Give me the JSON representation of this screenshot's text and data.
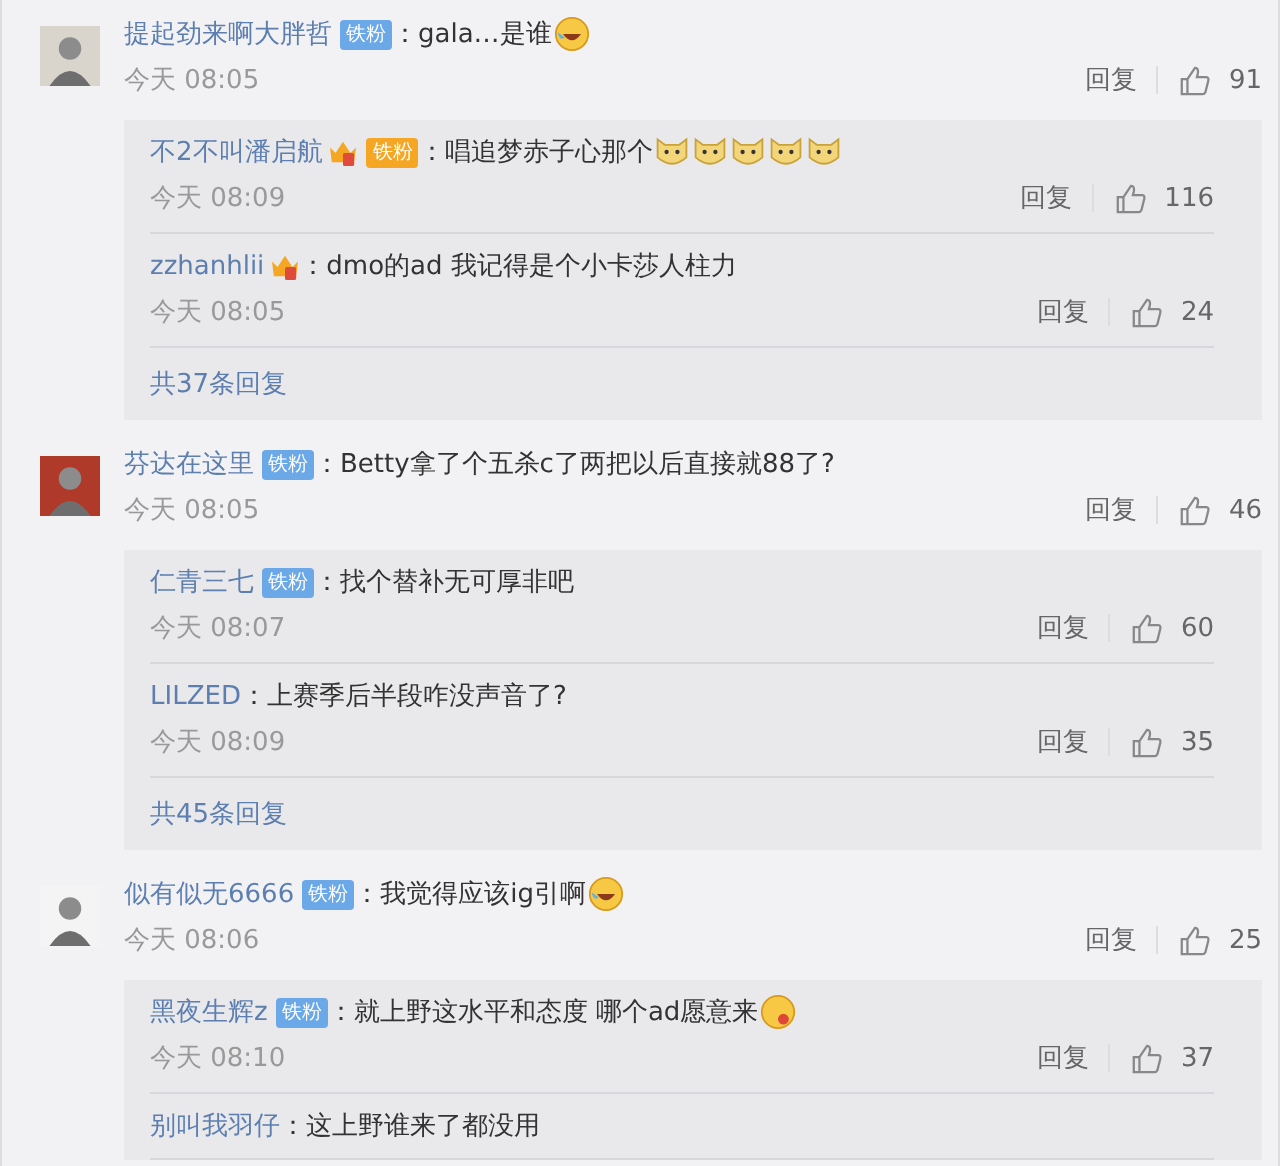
{
  "comments": [
    {
      "avatar": {
        "kind": "picture"
      },
      "name": "提起劲来啊大胖哲",
      "badges": [
        {
          "kind": "fan",
          "label": "铁粉",
          "color": "#6aa8e8"
        }
      ],
      "text": "：gala…是谁",
      "emojis": [
        {
          "kind": "laugh-cry"
        }
      ],
      "time": "今天 08:05",
      "reply_label": "回复",
      "likes": "91",
      "replies": [
        {
          "name": "不2不叫潘启航",
          "badges": [
            {
              "kind": "crown"
            },
            {
              "kind": "fan",
              "label": "铁粉",
              "color": "#f5a623"
            }
          ],
          "text": "：唱追梦赤子心那个",
          "emojis": [
            {
              "kind": "doge"
            },
            {
              "kind": "doge"
            },
            {
              "kind": "doge"
            },
            {
              "kind": "doge"
            },
            {
              "kind": "doge"
            }
          ],
          "time": "今天 08:09",
          "reply_label": "回复",
          "likes": "116"
        },
        {
          "name": "zzhanhlii",
          "badges": [
            {
              "kind": "crown"
            }
          ],
          "text": "：dmo的ad 我记得是个小卡莎人柱力",
          "time": "今天 08:05",
          "reply_label": "回复",
          "likes": "24"
        }
      ],
      "more": "共37条回复"
    },
    {
      "avatar": {
        "kind": "picture"
      },
      "name": "芬达在这里",
      "badges": [
        {
          "kind": "fan",
          "label": "铁粉",
          "color": "#6aa8e8"
        }
      ],
      "text": "：Betty拿了个五杀c了两把以后直接就88了?",
      "time": "今天 08:05",
      "reply_label": "回复",
      "likes": "46",
      "replies": [
        {
          "name": "仁青三七",
          "badges": [
            {
              "kind": "fan",
              "label": "铁粉",
              "color": "#6aa8e8"
            }
          ],
          "text": "：找个替补无可厚非吧",
          "time": "今天 08:07",
          "reply_label": "回复",
          "likes": "60"
        },
        {
          "name": "LILZED",
          "text": "：上赛季后半段咋没声音了?",
          "time": "今天 08:09",
          "reply_label": "回复",
          "likes": "35"
        }
      ],
      "more": "共45条回复"
    },
    {
      "avatar": {
        "kind": "picture"
      },
      "name": "似有似无6666",
      "badges": [
        {
          "kind": "fan",
          "label": "铁粉",
          "color": "#6aa8e8"
        }
      ],
      "text": "：我觉得应该ig引啊",
      "emojis": [
        {
          "kind": "laugh-cry"
        }
      ],
      "time": "今天 08:06",
      "reply_label": "回复",
      "likes": "25",
      "replies": [
        {
          "name": "黑夜生辉z",
          "badges": [
            {
              "kind": "fan",
              "label": "铁粉",
              "color": "#6aa8e8"
            }
          ],
          "text": "：就上野这水平和态度 哪个ad愿意来",
          "emojis": [
            {
              "kind": "drool"
            }
          ],
          "time": "今天 08:10",
          "reply_label": "回复",
          "likes": "37"
        },
        {
          "name": "别叫我羽仔",
          "text": "：这上野谁来了都没用"
        }
      ]
    }
  ]
}
